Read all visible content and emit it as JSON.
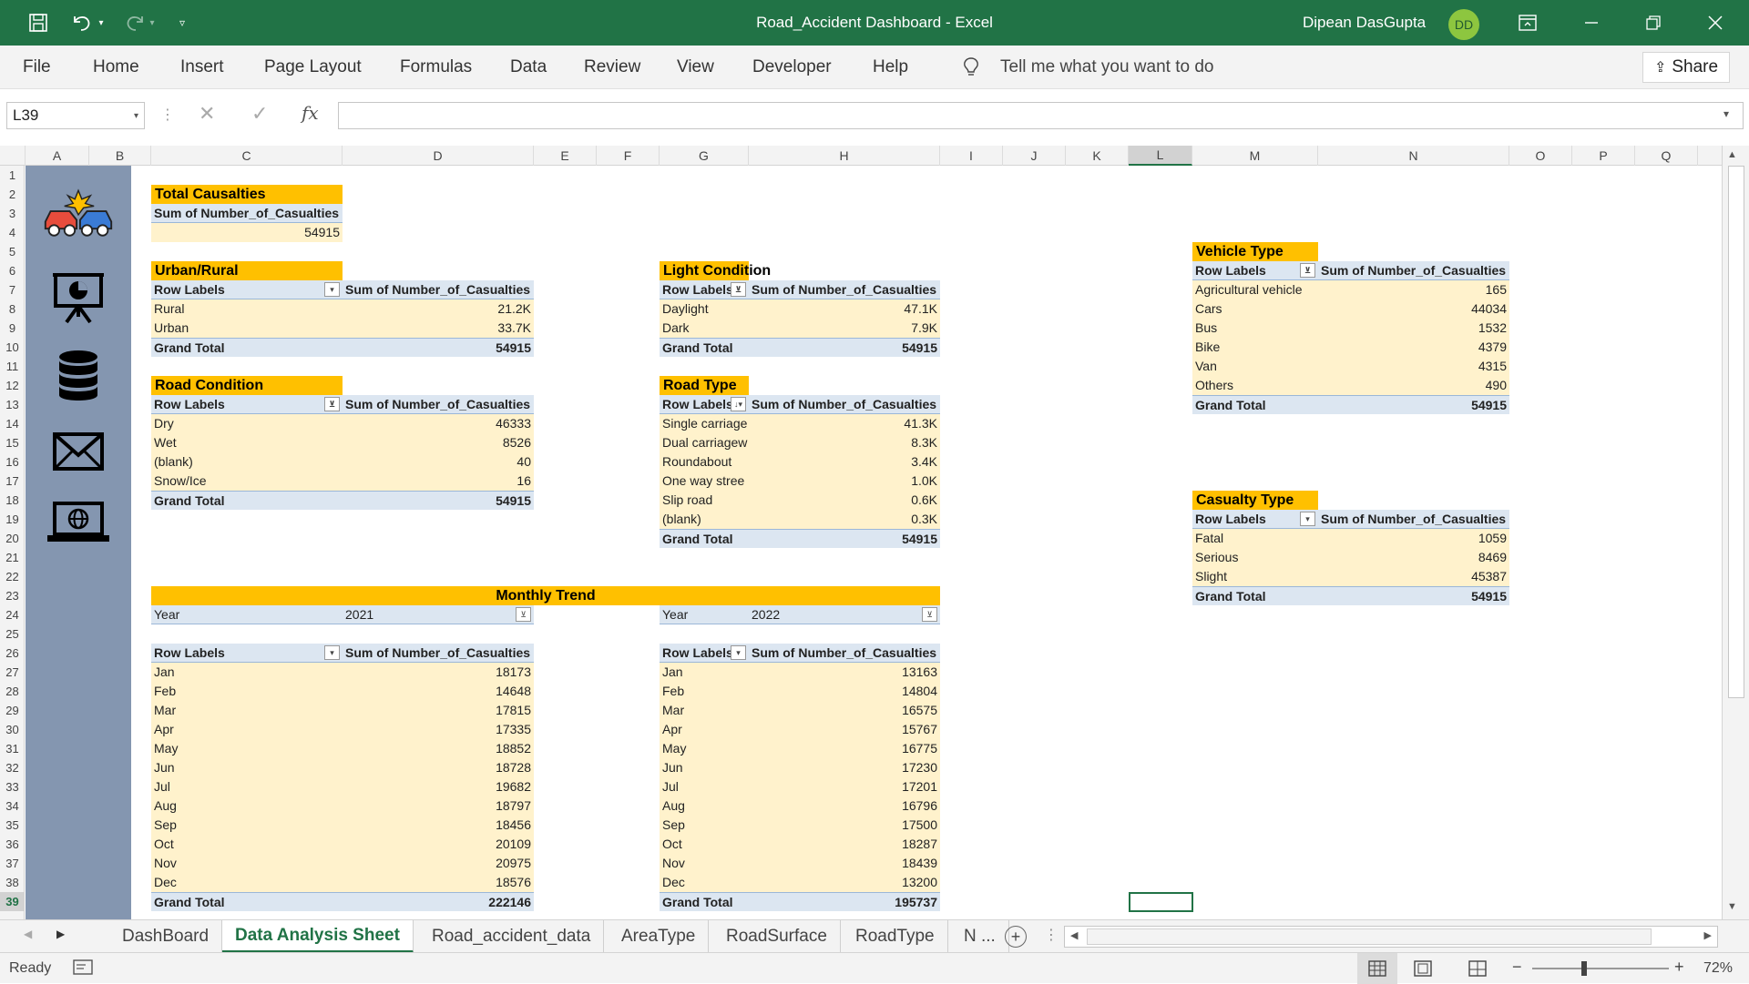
{
  "window": {
    "title": "Road_Accident Dashboard  -  Excel",
    "user": "Dipean DasGupta",
    "user_initials": "DD"
  },
  "ribbon": {
    "tabs": [
      "File",
      "Home",
      "Insert",
      "Page Layout",
      "Formulas",
      "Data",
      "Review",
      "View",
      "Developer",
      "Help"
    ],
    "tell_me": "Tell me what you want to do",
    "share": "Share"
  },
  "formula_bar": {
    "name_box": "L39",
    "fx": "fx",
    "value": ""
  },
  "columns": [
    "A",
    "B",
    "C",
    "D",
    "E",
    "F",
    "G",
    "H",
    "I",
    "J",
    "K",
    "L",
    "M",
    "N",
    "O",
    "P",
    "Q"
  ],
  "rows": [
    "1",
    "2",
    "3",
    "4",
    "5",
    "6",
    "7",
    "8",
    "9",
    "10",
    "11",
    "12",
    "13",
    "14",
    "15",
    "16",
    "17",
    "18",
    "19",
    "20",
    "21",
    "22",
    "23",
    "24",
    "25",
    "26",
    "27",
    "28",
    "29",
    "30",
    "31",
    "32",
    "33",
    "34",
    "35",
    "36",
    "37",
    "38",
    "39"
  ],
  "sidebar": {
    "icons": [
      "car-crash-icon",
      "presentation-chart-icon",
      "database-icon",
      "mail-icon",
      "laptop-globe-icon"
    ]
  },
  "total_casualties": {
    "title": "Total Causalties",
    "header": "Sum of Number_of_Casualties",
    "value": "54915"
  },
  "urban_rural": {
    "title": "Urban/Rural",
    "col1": "Row Labels",
    "col2": "Sum of Number_of_Casualties",
    "rows": [
      {
        "label": "Rural",
        "value": "21.2K"
      },
      {
        "label": "Urban",
        "value": "33.7K"
      }
    ],
    "total_label": "Grand Total",
    "total_value": "54915"
  },
  "road_condition": {
    "title": "Road Condition",
    "col1": "Row Labels",
    "col2": "Sum of Number_of_Casualties",
    "rows": [
      {
        "label": "Dry",
        "value": "46333"
      },
      {
        "label": "Wet",
        "value": "8526"
      },
      {
        "label": "(blank)",
        "value": "40"
      },
      {
        "label": "Snow/Ice",
        "value": "16"
      }
    ],
    "total_label": "Grand Total",
    "total_value": "54915"
  },
  "light_condition": {
    "title": "Light Condition",
    "col1": "Row Labels",
    "col2": "Sum of Number_of_Casualties",
    "rows": [
      {
        "label": "Daylight",
        "value": "47.1K"
      },
      {
        "label": "Dark",
        "value": "7.9K"
      }
    ],
    "total_label": "Grand Total",
    "total_value": "54915"
  },
  "road_type": {
    "title": "Road Type",
    "col1": "Row Labels",
    "col2": "Sum of Number_of_Casualties",
    "rows": [
      {
        "label": "Single carriage",
        "value": "41.3K"
      },
      {
        "label": "Dual carriagew",
        "value": "8.3K"
      },
      {
        "label": "Roundabout",
        "value": "3.4K"
      },
      {
        "label": "One way stree",
        "value": "1.0K"
      },
      {
        "label": "Slip road",
        "value": "0.6K"
      },
      {
        "label": "(blank)",
        "value": "0.3K"
      }
    ],
    "total_label": "Grand Total",
    "total_value": "54915"
  },
  "vehicle_type": {
    "title": "Vehicle Type",
    "col1": "Row Labels",
    "col2": "Sum of Number_of_Casualties",
    "rows": [
      {
        "label": "Agricultural vehicle",
        "value": "165"
      },
      {
        "label": "Cars",
        "value": "44034"
      },
      {
        "label": "Bus",
        "value": "1532"
      },
      {
        "label": "Bike",
        "value": "4379"
      },
      {
        "label": "Van",
        "value": "4315"
      },
      {
        "label": "Others",
        "value": "490"
      }
    ],
    "total_label": "Grand Total",
    "total_value": "54915"
  },
  "casualty_type": {
    "title": "Casualty Type",
    "col1": "Row Labels",
    "col2": "Sum of Number_of_Casualties",
    "rows": [
      {
        "label": "Fatal",
        "value": "1059"
      },
      {
        "label": "Serious",
        "value": "8469"
      },
      {
        "label": "Slight",
        "value": "45387"
      }
    ],
    "total_label": "Grand Total",
    "total_value": "54915"
  },
  "monthly_trend": {
    "title": "Monthly Trend",
    "filter_label": "Year",
    "left": {
      "year": "2021",
      "col1": "Row Labels",
      "col2": "Sum of Number_of_Casualties",
      "rows": [
        {
          "label": "Jan",
          "value": "18173"
        },
        {
          "label": "Feb",
          "value": "14648"
        },
        {
          "label": "Mar",
          "value": "17815"
        },
        {
          "label": "Apr",
          "value": "17335"
        },
        {
          "label": "May",
          "value": "18852"
        },
        {
          "label": "Jun",
          "value": "18728"
        },
        {
          "label": "Jul",
          "value": "19682"
        },
        {
          "label": "Aug",
          "value": "18797"
        },
        {
          "label": "Sep",
          "value": "18456"
        },
        {
          "label": "Oct",
          "value": "20109"
        },
        {
          "label": "Nov",
          "value": "20975"
        },
        {
          "label": "Dec",
          "value": "18576"
        }
      ],
      "total_label": "Grand Total",
      "total_value": "222146"
    },
    "right": {
      "year": "2022",
      "col1": "Row Labels",
      "col2": "Sum of Number_of_Casualties",
      "rows": [
        {
          "label": "Jan",
          "value": "13163"
        },
        {
          "label": "Feb",
          "value": "14804"
        },
        {
          "label": "Mar",
          "value": "16575"
        },
        {
          "label": "Apr",
          "value": "15767"
        },
        {
          "label": "May",
          "value": "16775"
        },
        {
          "label": "Jun",
          "value": "17230"
        },
        {
          "label": "Jul",
          "value": "17201"
        },
        {
          "label": "Aug",
          "value": "16796"
        },
        {
          "label": "Sep",
          "value": "17500"
        },
        {
          "label": "Oct",
          "value": "18287"
        },
        {
          "label": "Nov",
          "value": "18439"
        },
        {
          "label": "Dec",
          "value": "13200"
        }
      ],
      "total_label": "Grand Total",
      "total_value": "195737"
    }
  },
  "sheet_tabs": {
    "tabs": [
      "DashBoard",
      "Data Analysis Sheet",
      "Road_accident_data",
      "AreaType",
      "RoadSurface",
      "RoadType",
      "N ..."
    ],
    "active": "Data Analysis Sheet"
  },
  "status": {
    "ready": "Ready",
    "zoom": "72%"
  },
  "colors": {
    "excel_green": "#217346",
    "pivot_title": "#ffc000",
    "pivot_header": "#dce6f1",
    "pivot_row": "#fff2cc",
    "sidebar": "#8496b0"
  }
}
